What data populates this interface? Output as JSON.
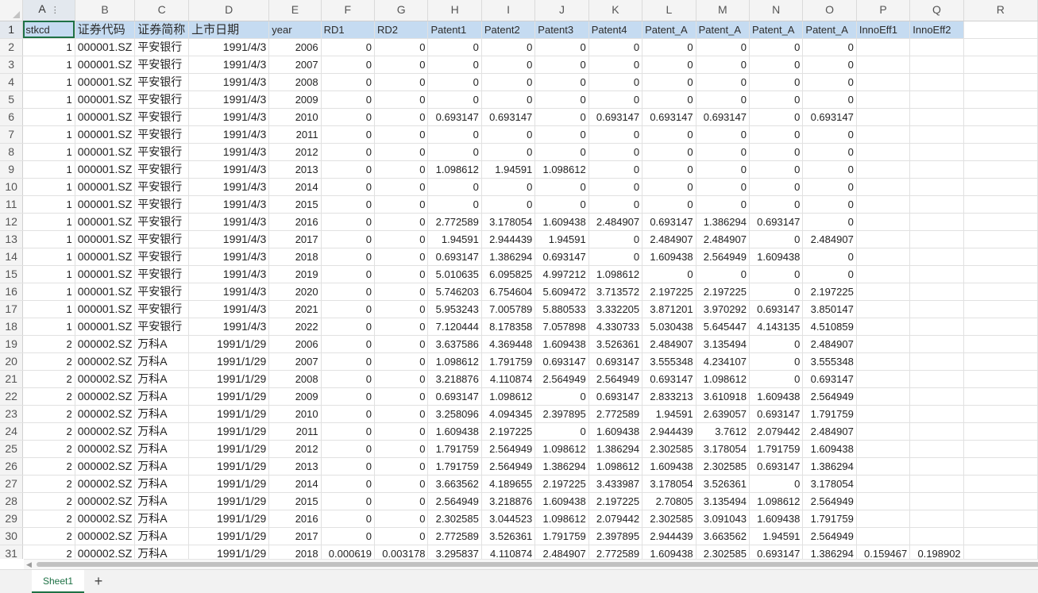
{
  "columns": [
    "A",
    "B",
    "C",
    "D",
    "E",
    "F",
    "G",
    "H",
    "I",
    "J",
    "K",
    "L",
    "M",
    "N",
    "O",
    "P",
    "Q",
    "R"
  ],
  "header_row": [
    "stkcd",
    "证券代码",
    "证券简称",
    "上市日期",
    "year",
    "RD1",
    "RD2",
    "Patent1",
    "Patent2",
    "Patent3",
    "Patent4",
    "Patent_A",
    "Patent_A",
    "Patent_A",
    "Patent_A",
    "InnoEff1",
    "InnoEff2",
    ""
  ],
  "rows": [
    [
      "1",
      "000001.SZ",
      "平安银行",
      "1991/4/3",
      "2006",
      "0",
      "0",
      "0",
      "0",
      "0",
      "0",
      "0",
      "0",
      "0",
      "0",
      "",
      ""
    ],
    [
      "1",
      "000001.SZ",
      "平安银行",
      "1991/4/3",
      "2007",
      "0",
      "0",
      "0",
      "0",
      "0",
      "0",
      "0",
      "0",
      "0",
      "0",
      "",
      ""
    ],
    [
      "1",
      "000001.SZ",
      "平安银行",
      "1991/4/3",
      "2008",
      "0",
      "0",
      "0",
      "0",
      "0",
      "0",
      "0",
      "0",
      "0",
      "0",
      "",
      ""
    ],
    [
      "1",
      "000001.SZ",
      "平安银行",
      "1991/4/3",
      "2009",
      "0",
      "0",
      "0",
      "0",
      "0",
      "0",
      "0",
      "0",
      "0",
      "0",
      "",
      ""
    ],
    [
      "1",
      "000001.SZ",
      "平安银行",
      "1991/4/3",
      "2010",
      "0",
      "0",
      "0.693147",
      "0.693147",
      "0",
      "0.693147",
      "0.693147",
      "0.693147",
      "0",
      "0.693147",
      "",
      ""
    ],
    [
      "1",
      "000001.SZ",
      "平安银行",
      "1991/4/3",
      "2011",
      "0",
      "0",
      "0",
      "0",
      "0",
      "0",
      "0",
      "0",
      "0",
      "0",
      "",
      ""
    ],
    [
      "1",
      "000001.SZ",
      "平安银行",
      "1991/4/3",
      "2012",
      "0",
      "0",
      "0",
      "0",
      "0",
      "0",
      "0",
      "0",
      "0",
      "0",
      "",
      ""
    ],
    [
      "1",
      "000001.SZ",
      "平安银行",
      "1991/4/3",
      "2013",
      "0",
      "0",
      "1.098612",
      "1.94591",
      "1.098612",
      "0",
      "0",
      "0",
      "0",
      "0",
      "",
      ""
    ],
    [
      "1",
      "000001.SZ",
      "平安银行",
      "1991/4/3",
      "2014",
      "0",
      "0",
      "0",
      "0",
      "0",
      "0",
      "0",
      "0",
      "0",
      "0",
      "",
      ""
    ],
    [
      "1",
      "000001.SZ",
      "平安银行",
      "1991/4/3",
      "2015",
      "0",
      "0",
      "0",
      "0",
      "0",
      "0",
      "0",
      "0",
      "0",
      "0",
      "",
      ""
    ],
    [
      "1",
      "000001.SZ",
      "平安银行",
      "1991/4/3",
      "2016",
      "0",
      "0",
      "2.772589",
      "3.178054",
      "1.609438",
      "2.484907",
      "0.693147",
      "1.386294",
      "0.693147",
      "0",
      "",
      ""
    ],
    [
      "1",
      "000001.SZ",
      "平安银行",
      "1991/4/3",
      "2017",
      "0",
      "0",
      "1.94591",
      "2.944439",
      "1.94591",
      "0",
      "2.484907",
      "2.484907",
      "0",
      "2.484907",
      "",
      ""
    ],
    [
      "1",
      "000001.SZ",
      "平安银行",
      "1991/4/3",
      "2018",
      "0",
      "0",
      "0.693147",
      "1.386294",
      "0.693147",
      "0",
      "1.609438",
      "2.564949",
      "1.609438",
      "0",
      "",
      ""
    ],
    [
      "1",
      "000001.SZ",
      "平安银行",
      "1991/4/3",
      "2019",
      "0",
      "0",
      "5.010635",
      "6.095825",
      "4.997212",
      "1.098612",
      "0",
      "0",
      "0",
      "0",
      "",
      ""
    ],
    [
      "1",
      "000001.SZ",
      "平安银行",
      "1991/4/3",
      "2020",
      "0",
      "0",
      "5.746203",
      "6.754604",
      "5.609472",
      "3.713572",
      "2.197225",
      "2.197225",
      "0",
      "2.197225",
      "",
      ""
    ],
    [
      "1",
      "000001.SZ",
      "平安银行",
      "1991/4/3",
      "2021",
      "0",
      "0",
      "5.953243",
      "7.005789",
      "5.880533",
      "3.332205",
      "3.871201",
      "3.970292",
      "0.693147",
      "3.850147",
      "",
      ""
    ],
    [
      "1",
      "000001.SZ",
      "平安银行",
      "1991/4/3",
      "2022",
      "0",
      "0",
      "7.120444",
      "8.178358",
      "7.057898",
      "4.330733",
      "5.030438",
      "5.645447",
      "4.143135",
      "4.510859",
      "",
      ""
    ],
    [
      "2",
      "000002.SZ",
      "万科A",
      "1991/1/29",
      "2006",
      "0",
      "0",
      "3.637586",
      "4.369448",
      "1.609438",
      "3.526361",
      "2.484907",
      "3.135494",
      "0",
      "2.484907",
      "",
      ""
    ],
    [
      "2",
      "000002.SZ",
      "万科A",
      "1991/1/29",
      "2007",
      "0",
      "0",
      "1.098612",
      "1.791759",
      "0.693147",
      "0.693147",
      "3.555348",
      "4.234107",
      "0",
      "3.555348",
      "",
      ""
    ],
    [
      "2",
      "000002.SZ",
      "万科A",
      "1991/1/29",
      "2008",
      "0",
      "0",
      "3.218876",
      "4.110874",
      "2.564949",
      "2.564949",
      "0.693147",
      "1.098612",
      "0",
      "0.693147",
      "",
      ""
    ],
    [
      "2",
      "000002.SZ",
      "万科A",
      "1991/1/29",
      "2009",
      "0",
      "0",
      "0.693147",
      "1.098612",
      "0",
      "0.693147",
      "2.833213",
      "3.610918",
      "1.609438",
      "2.564949",
      "",
      ""
    ],
    [
      "2",
      "000002.SZ",
      "万科A",
      "1991/1/29",
      "2010",
      "0",
      "0",
      "3.258096",
      "4.094345",
      "2.397895",
      "2.772589",
      "1.94591",
      "2.639057",
      "0.693147",
      "1.791759",
      "",
      ""
    ],
    [
      "2",
      "000002.SZ",
      "万科A",
      "1991/1/29",
      "2011",
      "0",
      "0",
      "1.609438",
      "2.197225",
      "0",
      "1.609438",
      "2.944439",
      "3.7612",
      "2.079442",
      "2.484907",
      "",
      ""
    ],
    [
      "2",
      "000002.SZ",
      "万科A",
      "1991/1/29",
      "2012",
      "0",
      "0",
      "1.791759",
      "2.564949",
      "1.098612",
      "1.386294",
      "2.302585",
      "3.178054",
      "1.791759",
      "1.609438",
      "",
      ""
    ],
    [
      "2",
      "000002.SZ",
      "万科A",
      "1991/1/29",
      "2013",
      "0",
      "0",
      "1.791759",
      "2.564949",
      "1.386294",
      "1.098612",
      "1.609438",
      "2.302585",
      "0.693147",
      "1.386294",
      "",
      ""
    ],
    [
      "2",
      "000002.SZ",
      "万科A",
      "1991/1/29",
      "2014",
      "0",
      "0",
      "3.663562",
      "4.189655",
      "2.197225",
      "3.433987",
      "3.178054",
      "3.526361",
      "0",
      "3.178054",
      "",
      ""
    ],
    [
      "2",
      "000002.SZ",
      "万科A",
      "1991/1/29",
      "2015",
      "0",
      "0",
      "2.564949",
      "3.218876",
      "1.609438",
      "2.197225",
      "2.70805",
      "3.135494",
      "1.098612",
      "2.564949",
      "",
      ""
    ],
    [
      "2",
      "000002.SZ",
      "万科A",
      "1991/1/29",
      "2016",
      "0",
      "0",
      "2.302585",
      "3.044523",
      "1.098612",
      "2.079442",
      "2.302585",
      "3.091043",
      "1.609438",
      "1.791759",
      "",
      ""
    ],
    [
      "2",
      "000002.SZ",
      "万科A",
      "1991/1/29",
      "2017",
      "0",
      "0",
      "2.772589",
      "3.526361",
      "1.791759",
      "2.397895",
      "2.944439",
      "3.663562",
      "1.94591",
      "2.564949",
      "",
      ""
    ],
    [
      "2",
      "000002.SZ",
      "万科A",
      "1991/1/29",
      "2018",
      "0.000619",
      "0.003178",
      "3.295837",
      "4.110874",
      "2.484907",
      "2.772589",
      "1.609438",
      "2.302585",
      "0.693147",
      "1.386294",
      "0.159467",
      "0.198902"
    ]
  ],
  "header_dots": "⋮",
  "scroll": {
    "left_arrow": "◀",
    "right_arrow": "▶"
  },
  "tabs": {
    "sheet1": "Sheet1",
    "add": "+"
  }
}
